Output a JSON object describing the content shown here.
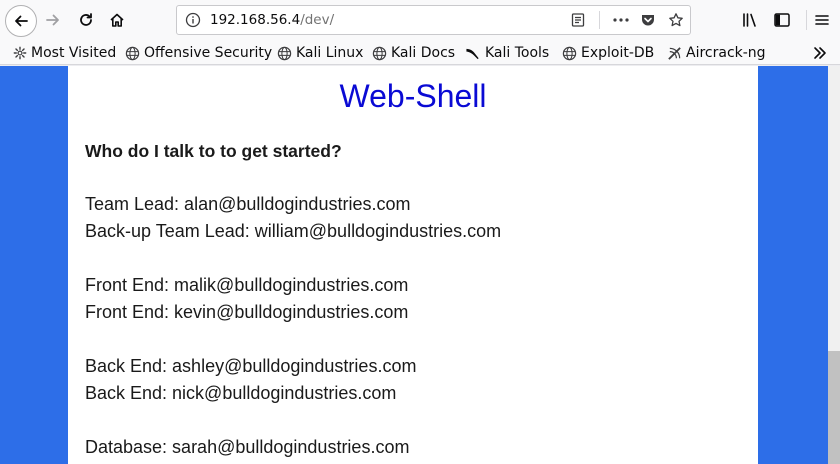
{
  "browser": {
    "url_host": "192.168.56.4",
    "url_path": "/dev/",
    "icons": [
      "back-icon",
      "forward-icon",
      "reload-icon",
      "home-icon",
      "info-icon",
      "reader-view-icon",
      "more-icon",
      "pocket-icon",
      "star-icon",
      "library-icon",
      "sidebar-icon",
      "menu-icon",
      "bookmarks-overflow-icon"
    ]
  },
  "bookmarks": [
    {
      "label": "Most Visited",
      "icon": "gear-icon"
    },
    {
      "label": "Offensive Security",
      "icon": "globe-icon"
    },
    {
      "label": "Kali Linux",
      "icon": "globe-icon"
    },
    {
      "label": "Kali Docs",
      "icon": "globe-icon"
    },
    {
      "label": "Kali Tools",
      "icon": "kali-icon"
    },
    {
      "label": "Exploit-DB",
      "icon": "globe-icon"
    },
    {
      "label": "Aircrack-ng",
      "icon": "aircrack-icon"
    }
  ],
  "page": {
    "title": "Web-Shell",
    "question": "Who do I talk to to get started?",
    "contacts": [
      "Team Lead: alan@bulldogindustries.com",
      "Back-up Team Lead: william@bulldogindustries.com",
      "Front End: malik@bulldogindustries.com",
      "Front End: kevin@bulldogindustries.com",
      "Back End: ashley@bulldogindustries.com",
      "Back End: nick@bulldogindustries.com",
      "Database: sarah@bulldogindustries.com"
    ]
  },
  "colors": {
    "page_background": "#2d6ee8",
    "title": "#0a0ad4",
    "content_background": "#ffffff"
  }
}
